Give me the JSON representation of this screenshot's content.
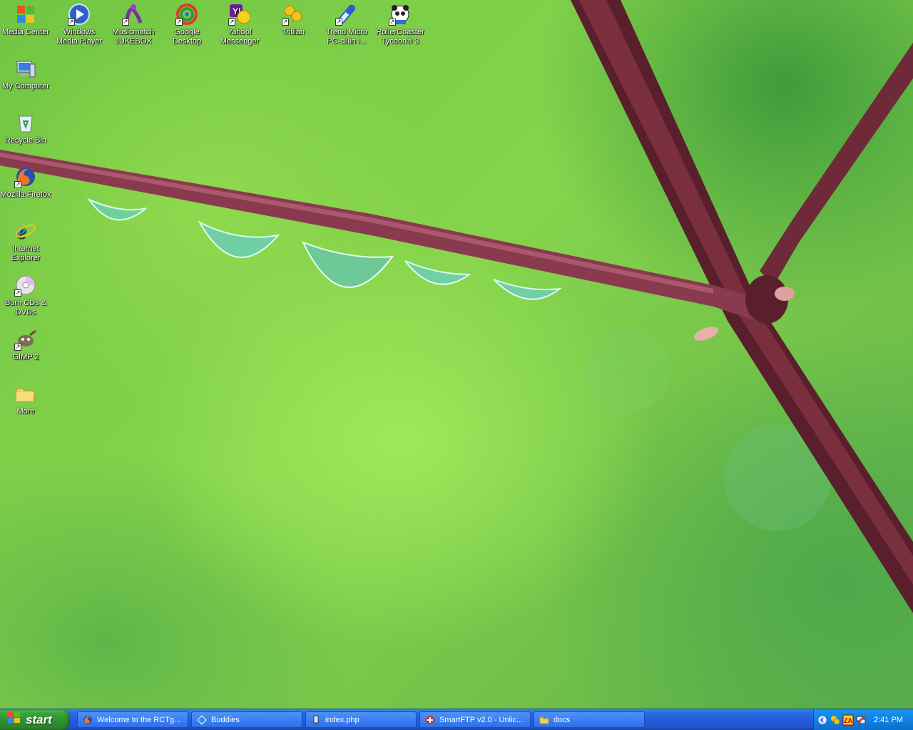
{
  "desktop_icons": [
    {
      "label": "Media Center"
    },
    {
      "label": "Windows Media Player"
    },
    {
      "label": "Musicmatch JUKEBOX"
    },
    {
      "label": "Google Desktop"
    },
    {
      "label": "Yahoo! Messenger"
    },
    {
      "label": "Trillian"
    },
    {
      "label": "Trend Micro PC-cillin I..."
    },
    {
      "label": "RollerCoaster Tycoon® 3"
    },
    {
      "label": "My Computer"
    },
    {
      "label": "Recycle Bin"
    },
    {
      "label": "Mozilla Firefox"
    },
    {
      "label": "Internet Explorer"
    },
    {
      "label": "Burn CDs & DVDs"
    },
    {
      "label": "GIMP 2"
    },
    {
      "label": "More"
    }
  ],
  "taskbar": {
    "start_label": "start",
    "tasks": [
      {
        "label": "Welcome to the RCTg..."
      },
      {
        "label": "Buddies"
      },
      {
        "label": "index.php"
      },
      {
        "label": "SmartFTP v2.0 - Unlic..."
      },
      {
        "label": "docs"
      }
    ],
    "clock": "2:41 PM"
  },
  "colors": {
    "taskbar_blue": "#245edb",
    "start_green": "#3aa33a",
    "tray_blue": "#0f82e4",
    "wallpaper_green": "#86d44c",
    "stem_red": "#8a3a4e"
  }
}
